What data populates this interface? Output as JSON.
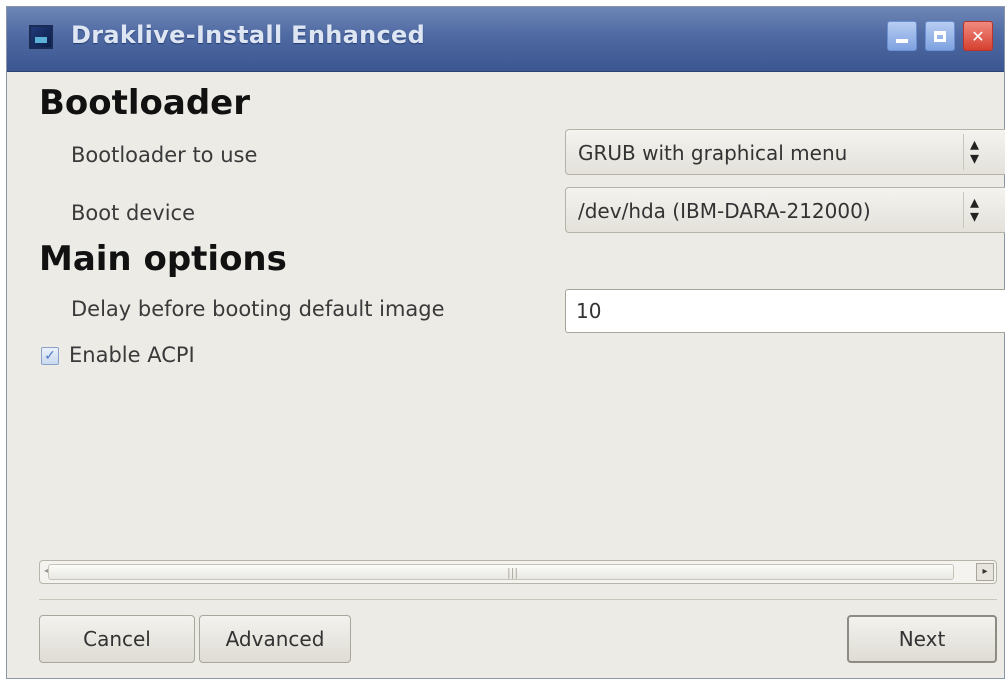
{
  "window": {
    "title": "Draklive-Install Enhanced",
    "icons": {
      "app": "drakx-app-icon",
      "minimize": "minimize-icon",
      "maximize": "maximize-icon",
      "close": "close-icon"
    }
  },
  "bootloader": {
    "heading": "Bootloader",
    "bootloader_label": "Bootloader to use",
    "bootloader_value": "GRUB with graphical menu",
    "device_label": "Boot device",
    "device_value": "/dev/hda (IBM-DARA-212000)"
  },
  "main_options": {
    "heading": "Main options",
    "delay_label": "Delay before booting default image",
    "delay_value": "10",
    "acpi_label": "Enable ACPI",
    "acpi_checked": true
  },
  "buttons": {
    "cancel": "Cancel",
    "advanced": "Advanced",
    "next": "Next"
  },
  "colors": {
    "titlebar": "#4f6aa3",
    "window_bg": "#ecebe6",
    "close_button": "#d6402f"
  }
}
